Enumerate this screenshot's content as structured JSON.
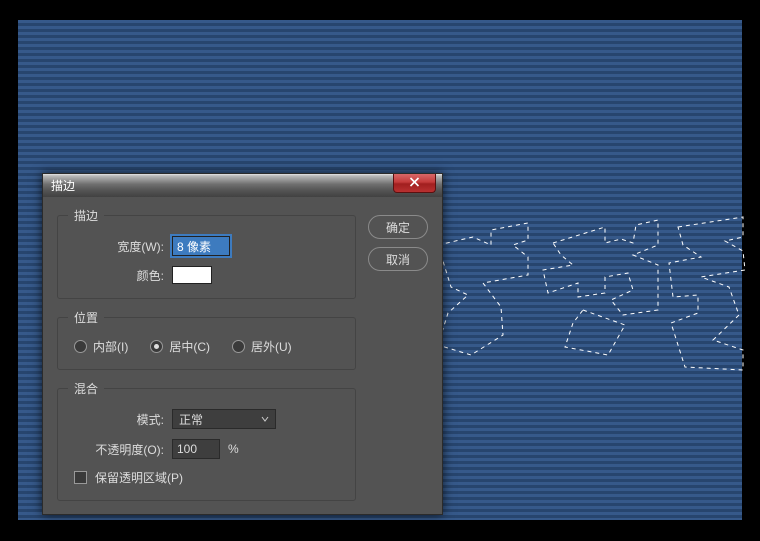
{
  "dialog": {
    "title": "描边",
    "sections": {
      "stroke": {
        "legend": "描边",
        "width_label": "宽度(W):",
        "width_value": "8 像素",
        "color_label": "颜色:",
        "color_value": "#ffffff"
      },
      "position": {
        "legend": "位置",
        "options": [
          {
            "label": "内部(I)",
            "checked": false
          },
          {
            "label": "居中(C)",
            "checked": true
          },
          {
            "label": "居外(U)",
            "checked": false
          }
        ]
      },
      "blend": {
        "legend": "混合",
        "mode_label": "模式:",
        "mode_value": "正常",
        "opacity_label": "不透明度(O):",
        "opacity_value": "100",
        "opacity_unit": "%",
        "preserve_label": "保留透明区域(P)",
        "preserve_checked": false
      }
    },
    "buttons": {
      "ok": "确定",
      "cancel": "取消"
    }
  }
}
